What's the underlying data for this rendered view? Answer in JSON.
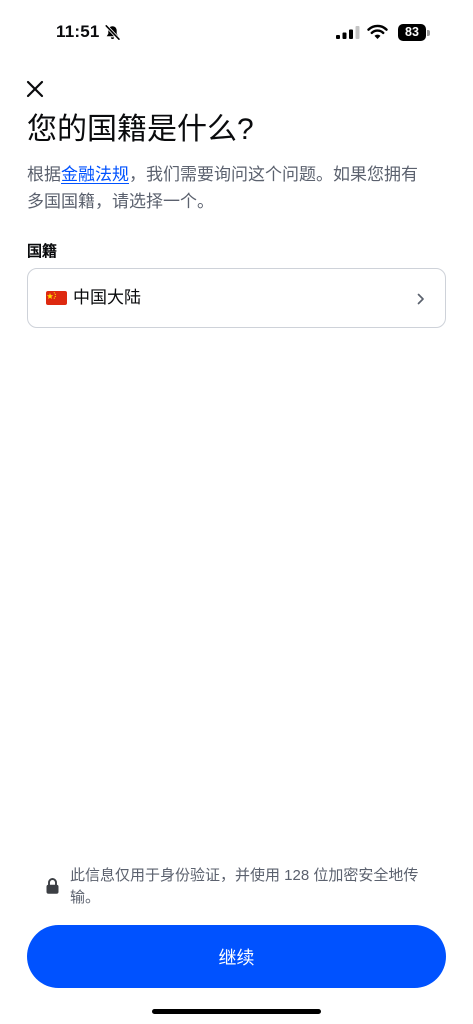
{
  "status_bar": {
    "time": "11:51",
    "battery": "83",
    "icons": [
      "bell-slash-icon",
      "cellular-signal-icon",
      "wifi-icon",
      "battery-icon"
    ]
  },
  "header": {
    "close_icon": "close-icon"
  },
  "title": "您的国籍是什么?",
  "subtitle": {
    "before": "根据",
    "link": "金融法规",
    "after": "，我们需要询问这个问题。如果您拥有多国国籍，请选择一个。"
  },
  "nationality": {
    "label": "国籍",
    "selected": "中国大陆",
    "flag_icon": "china-flag-icon",
    "chevron_icon": "chevron-right-icon"
  },
  "footer": {
    "lock_icon": "lock-icon",
    "security_note": "此信息仅用于身份验证，并使用 128 位加密安全地传输。",
    "continue_label": "继续"
  },
  "colors": {
    "accent": "#0052FF",
    "text": "#0A0B0D",
    "muted": "#5B616E",
    "border": "#CED2D9"
  }
}
